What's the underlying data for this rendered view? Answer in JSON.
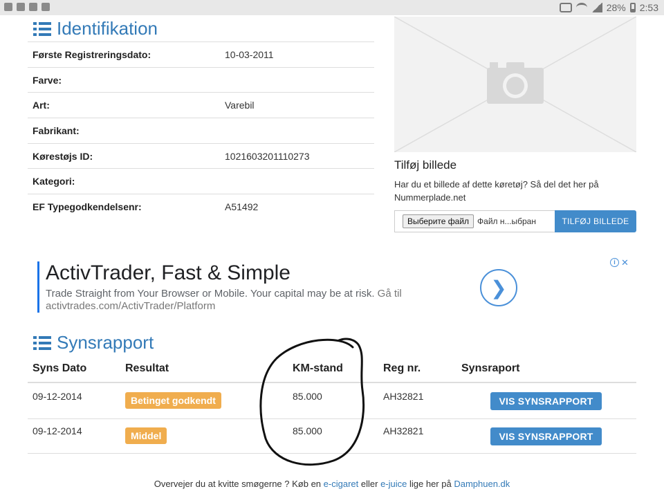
{
  "status_bar": {
    "battery": "28%",
    "time": "2:53"
  },
  "identifikation": {
    "title": "Identifikation",
    "rows": [
      {
        "label": "Første Registreringsdato:",
        "value": "10-03-2011"
      },
      {
        "label": "Farve:",
        "value": ""
      },
      {
        "label": "Art:",
        "value": "Varebil"
      },
      {
        "label": "Fabrikant:",
        "value": ""
      },
      {
        "label": "Kørestøjs ID:",
        "value": "1021603201110273"
      },
      {
        "label": "Kategori:",
        "value": ""
      },
      {
        "label": "EF Typegodkendelsenr:",
        "value": "A51492"
      }
    ]
  },
  "photo": {
    "title": "Tilføj billede",
    "description": "Har du et billede af dette køretøj? Så del det her på Nummerplade.net",
    "file_button": "Выберите файл",
    "file_name": "Файл н...ыбран",
    "add_button": "TILFØJ BILLEDE"
  },
  "ad": {
    "title": "ActivTrader, Fast & Simple",
    "description": "Trade Straight from Your Browser or Mobile. Your capital may be at risk.",
    "link": "Gå til activtrades.com/ActivTrader/Platform"
  },
  "synsrapport": {
    "title": "Synsrapport",
    "headers": [
      "Syns Dato",
      "Resultat",
      "KM-stand",
      "Reg nr.",
      "Synsraport"
    ],
    "rows": [
      {
        "date": "09-12-2014",
        "result": "Betinget godkendt",
        "km": "85.000",
        "reg": "AH32821",
        "action": "VIS SYNSRAPPORT"
      },
      {
        "date": "09-12-2014",
        "result": "Middel",
        "km": "85.000",
        "reg": "AH32821",
        "action": "VIS SYNSRAPPORT"
      }
    ]
  },
  "footer": {
    "text1": "Overvejer du at kvitte smøgerne ? Køb en",
    "link1": "e-cigaret",
    "text2": "eller",
    "link2": "e-juice",
    "text3": "lige her på",
    "link3": "Damphuen.dk"
  },
  "colors": {
    "primary": "#337ab7",
    "button": "#428bca",
    "badge": "#f0ad4e"
  }
}
